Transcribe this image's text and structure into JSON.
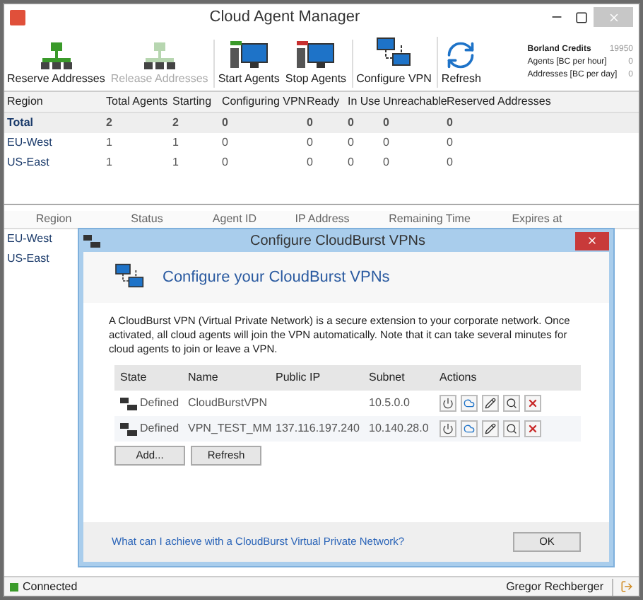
{
  "window": {
    "title": "Cloud Agent Manager"
  },
  "toolbar": [
    {
      "label": "Reserve Addresses",
      "kind": "reserve",
      "disabled": false
    },
    {
      "label": "Release Addresses",
      "kind": "release",
      "disabled": true
    },
    {
      "label": "Start Agents",
      "kind": "start",
      "disabled": false
    },
    {
      "label": "Stop Agents",
      "kind": "stop",
      "disabled": false
    },
    {
      "label": "Configure VPN",
      "kind": "vpn",
      "disabled": false
    },
    {
      "label": "Refresh",
      "kind": "refresh",
      "disabled": false
    }
  ],
  "credits": [
    {
      "label": "Borland Credits",
      "value": "19950"
    },
    {
      "label": "Agents [BC per hour]",
      "value": "0"
    },
    {
      "label": "Addresses [BC per day]",
      "value": "0"
    }
  ],
  "summary_table": {
    "columns": [
      "Region",
      "Total Agents",
      "Starting",
      "Configuring VPN",
      "Ready",
      "In Use",
      "Unreachable",
      "Reserved Addresses"
    ],
    "rows": [
      {
        "bold": true,
        "cells": [
          "Total",
          "2",
          "2",
          "0",
          "0",
          "0",
          "0",
          "0"
        ]
      },
      {
        "bold": false,
        "cells": [
          "EU-West",
          "1",
          "1",
          "0",
          "0",
          "0",
          "0",
          "0"
        ]
      },
      {
        "bold": false,
        "cells": [
          "US-East",
          "1",
          "1",
          "0",
          "0",
          "0",
          "0",
          "0"
        ]
      }
    ]
  },
  "agents_table": {
    "columns": [
      "Region",
      "Status",
      "Agent ID",
      "IP Address",
      "Remaining Time",
      "Expires at"
    ],
    "regions": [
      "EU-West",
      "US-East"
    ]
  },
  "dialog": {
    "title": "Configure CloudBurst VPNs",
    "heading": "Configure your CloudBurst VPNs",
    "description": "A CloudBurst VPN (Virtual Private Network) is a secure extension to your corporate network. Once activated, all cloud agents will join the VPN automatically. Note that it can take several minutes for cloud agents to join or leave a VPN.",
    "columns": [
      "State",
      "Name",
      "Public IP",
      "Subnet",
      "Actions"
    ],
    "rows": [
      {
        "state": "Defined",
        "name": "CloudBurstVPN",
        "public_ip": "",
        "subnet": "10.5.0.0"
      },
      {
        "state": "Defined",
        "name": "VPN_TEST_MM",
        "public_ip": "137.116.197.240",
        "subnet": "10.140.28.0"
      }
    ],
    "buttons": [
      "Add...",
      "Refresh"
    ],
    "link": "What can I achieve with a CloudBurst Virtual Private Network?",
    "ok": "OK"
  },
  "status_bar": {
    "connection": "Connected",
    "user": "Gregor Rechberger"
  }
}
